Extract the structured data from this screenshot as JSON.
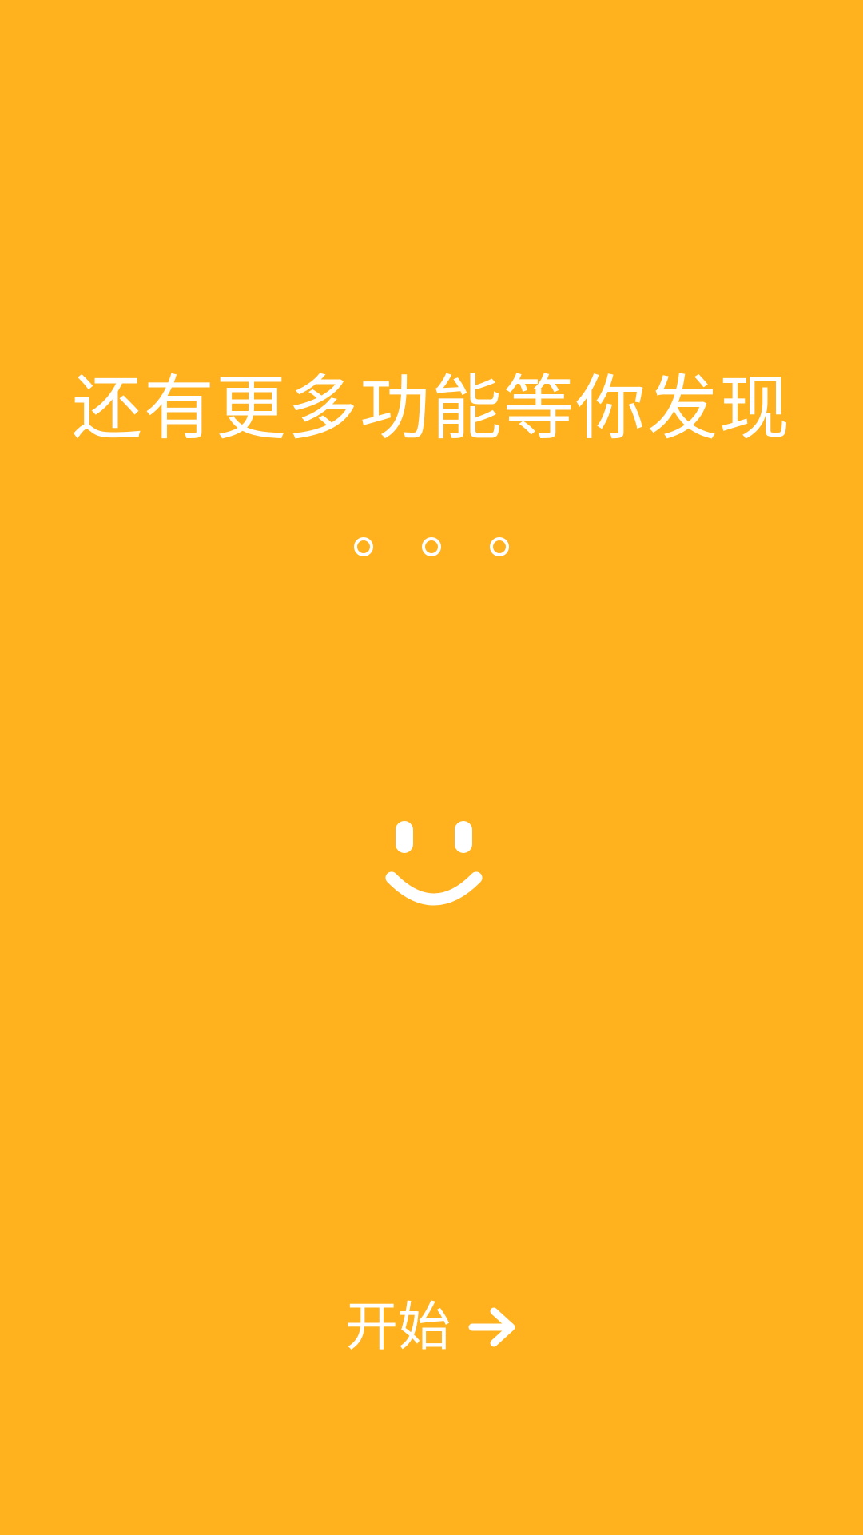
{
  "theme": {
    "background": "#FFB21E",
    "foreground": "#FFFFFF"
  },
  "headline": "还有更多功能等你发现",
  "page_indicator": {
    "count": 3,
    "icon": "hollow-circle-dot"
  },
  "illustration": {
    "icon": "smiley-face-icon"
  },
  "start_button": {
    "label": "开始",
    "icon": "arrow-right-icon"
  }
}
